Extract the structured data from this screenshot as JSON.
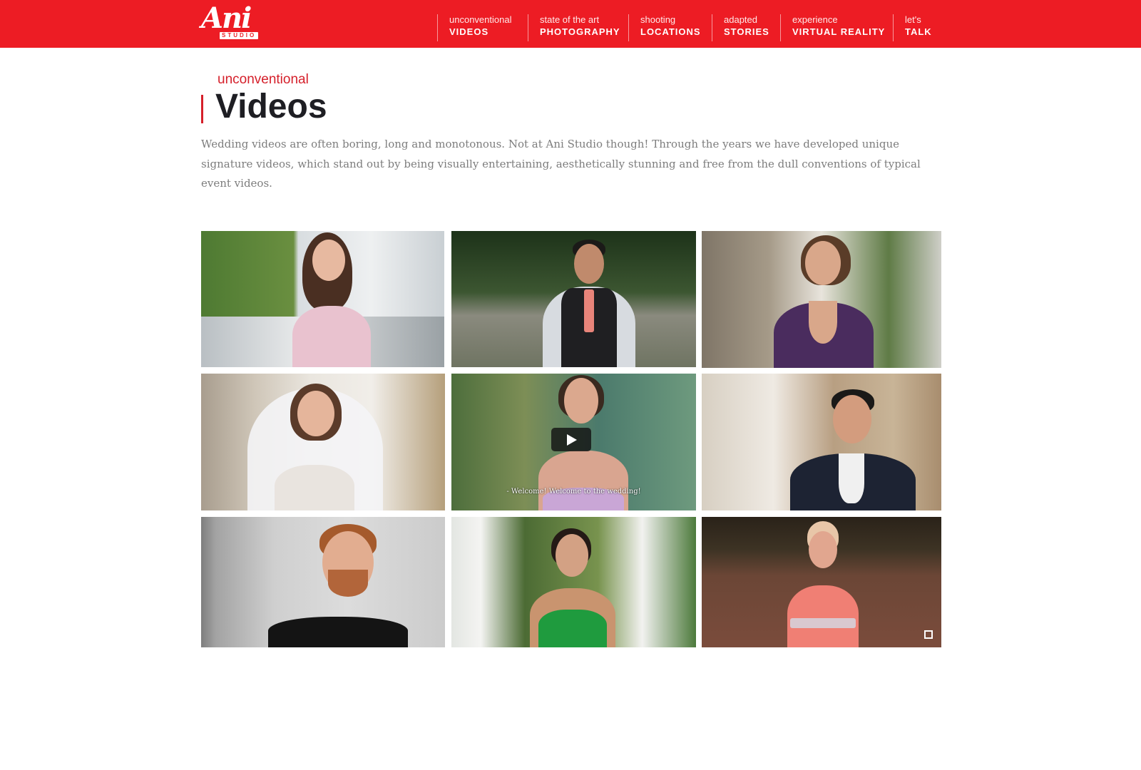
{
  "logo": {
    "script": "Ani",
    "sub": "STUDIO"
  },
  "nav": [
    {
      "small": "unconventional",
      "big": "VIDEOS"
    },
    {
      "small": "state of the art",
      "big": "PHOTOGRAPHY"
    },
    {
      "small": "shooting",
      "big": "LOCATIONS"
    },
    {
      "small": "adapted",
      "big": "STORIES"
    },
    {
      "small": "experience",
      "big": "VIRTUAL REALITY"
    },
    {
      "small": "let's",
      "big": "TALK"
    }
  ],
  "page": {
    "eyebrow": "unconventional",
    "title": "Videos",
    "intro": "Wedding videos are often boring, long and monotonous. Not at Ani Studio though! Through the years we have developed unique signature videos, which stand out by being visually entertaining, aesthetically stunning and free from the dull conventions of typical event videos."
  },
  "colors": {
    "brand_red": "#ed1c24",
    "accent_red": "#d51f2a",
    "heading": "#1e1e23",
    "body_text": "#7d7d7d"
  },
  "video_caption": "- Welcome! Welcome to the wedding!",
  "icons": {
    "play": "play-icon",
    "fullscreen": "fullscreen-icon"
  }
}
